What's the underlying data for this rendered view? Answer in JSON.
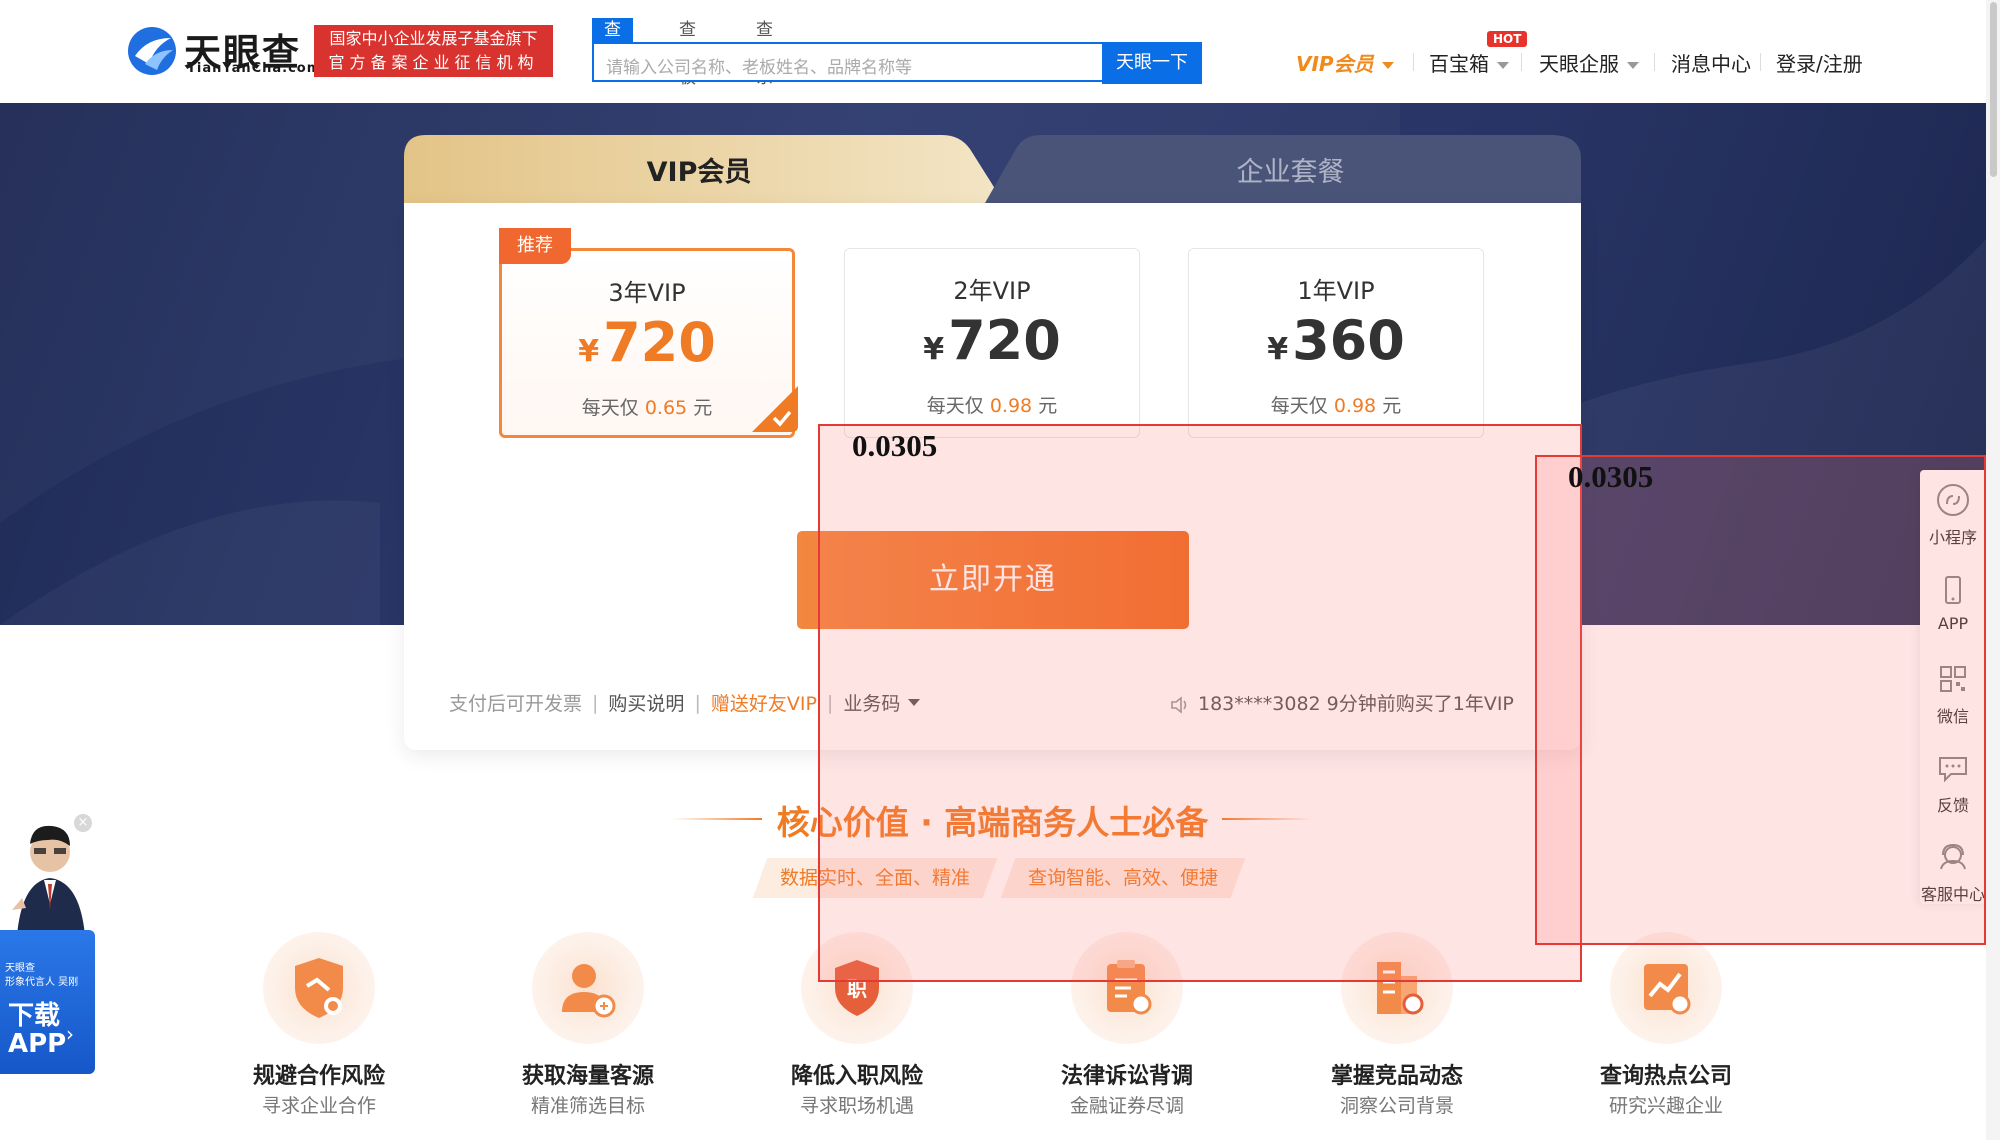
{
  "header": {
    "logo_cn": "天眼查",
    "logo_en": "TianYanCha.com",
    "gov_badge_line1": "国家中小企业发展子基金旗下",
    "gov_badge_line2": "官方备案企业征信机构",
    "search_tabs": [
      "查公司",
      "查老板",
      "查关系"
    ],
    "search_placeholder": "请输入公司名称、老板姓名、品牌名称等",
    "search_button": "天眼一下",
    "nav": {
      "vip": "VIP会员",
      "toolbox": "百宝箱",
      "hot": "HOT",
      "enterprise": "天眼企服",
      "messages": "消息中心",
      "login": "登录/注册"
    }
  },
  "tabs": {
    "vip": "VIP会员",
    "enterprise": "企业套餐"
  },
  "plans": [
    {
      "name": "3年VIP",
      "currency": "¥",
      "price": "720",
      "daily_prefix": "每天仅",
      "daily_value": "0.65",
      "daily_suffix": "元",
      "badge": "推荐",
      "selected": true
    },
    {
      "name": "2年VIP",
      "currency": "¥",
      "price": "720",
      "daily_prefix": "每天仅",
      "daily_value": "0.98",
      "daily_suffix": "元",
      "selected": false
    },
    {
      "name": "1年VIP",
      "currency": "¥",
      "price": "360",
      "daily_prefix": "每天仅",
      "daily_value": "0.98",
      "daily_suffix": "元",
      "selected": false
    }
  ],
  "cta": "立即开通",
  "footer_links": {
    "invoice": "支付后可开发票",
    "instructions": "购买说明",
    "gift": "赠送好友VIP",
    "business_code": "业务码"
  },
  "purchase_notice": "183****3082 9分钟前购买了1年VIP",
  "core": {
    "title": "核心价值 · 高端商务人士必备",
    "chips": [
      "数据实时、全面、精准",
      "查询智能、高效、便捷"
    ],
    "features": [
      {
        "title": "规避合作风险",
        "sub": "寻求企业合作",
        "icon": "shield-handshake-icon"
      },
      {
        "title": "获取海量客源",
        "sub": "精准筛选目标",
        "icon": "user-search-icon"
      },
      {
        "title": "降低入职风险",
        "sub": "寻求职场机遇",
        "icon": "shield-job-icon"
      },
      {
        "title": "法律诉讼背调",
        "sub": "金融证券尽调",
        "icon": "clipboard-search-icon"
      },
      {
        "title": "掌握竞品动态",
        "sub": "洞察公司背景",
        "icon": "building-chart-icon"
      },
      {
        "title": "查询热点公司",
        "sub": "研究兴趣企业",
        "icon": "trend-search-icon"
      }
    ]
  },
  "sidebar": [
    {
      "label": "小程序",
      "icon": "mini-program-icon"
    },
    {
      "label": "APP",
      "icon": "phone-icon"
    },
    {
      "label": "微信",
      "icon": "qr-code-icon"
    },
    {
      "label": "反馈",
      "icon": "chat-bubble-icon"
    },
    {
      "label": "客服中心",
      "icon": "headset-icon"
    }
  ],
  "app_ad": {
    "brand": "天眼查",
    "spokesperson": "形象代言人 吴刚",
    "download_line1": "下载",
    "download_line2": "APP",
    "close": "×"
  },
  "overlays": [
    {
      "label": "0.0305"
    },
    {
      "label": "0.0305"
    }
  ],
  "colors": {
    "brand_blue": "#0a6ee6",
    "accent_orange": "#f07b25",
    "badge_red": "#d9332f",
    "banner_navy": "#283465"
  }
}
